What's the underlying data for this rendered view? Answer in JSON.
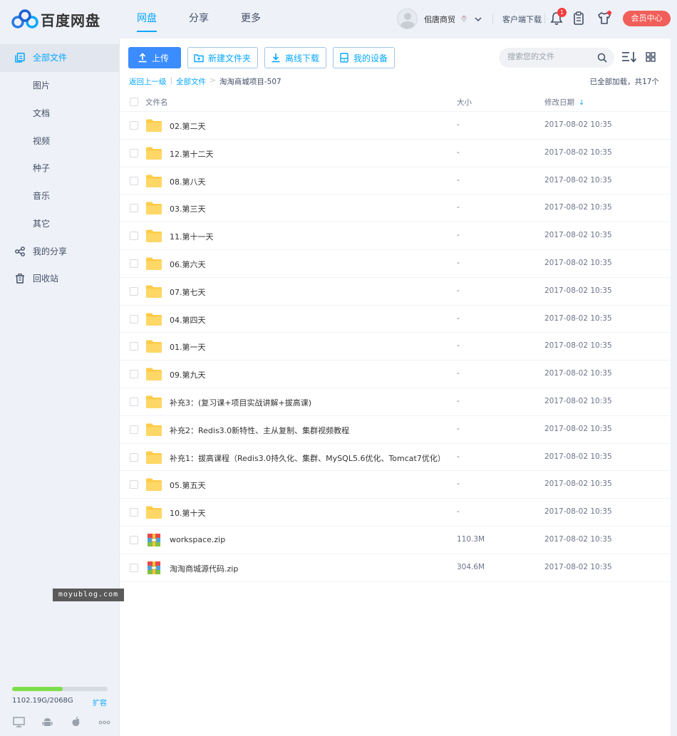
{
  "header": {
    "logo_text": "百度网盘",
    "nav": [
      {
        "label": "网盘",
        "active": true
      },
      {
        "label": "分享",
        "active": false
      },
      {
        "label": "更多",
        "active": false
      }
    ],
    "username": "佀唐商贸",
    "client_download": "客户端下载",
    "notification_count": "1",
    "vip_button": "会员中心"
  },
  "sidebar": {
    "items": [
      {
        "label": "全部文件",
        "icon": "files-icon",
        "active": true
      },
      {
        "label": "图片"
      },
      {
        "label": "文档"
      },
      {
        "label": "视频"
      },
      {
        "label": "种子"
      },
      {
        "label": "音乐"
      },
      {
        "label": "其它"
      },
      {
        "label": "我的分享",
        "icon": "share-icon"
      },
      {
        "label": "回收站",
        "icon": "trash-icon"
      }
    ],
    "storage": {
      "text": "1102.19G/2068G",
      "used_fraction": 0.533,
      "expand_label": "扩容"
    }
  },
  "toolbar": {
    "upload": "上传",
    "new_folder": "新建文件夹",
    "offline_download": "离线下载",
    "my_devices": "我的设备"
  },
  "search": {
    "placeholder": "搜索您的文件"
  },
  "breadcrumb": {
    "back": "返回上一级",
    "root": "全部文件",
    "current": "淘淘商城项目-507"
  },
  "load_status": "已全部加载，共17个",
  "table": {
    "columns": {
      "name": "文件名",
      "size": "大小",
      "date": "修改日期"
    },
    "rows": [
      {
        "name": "02.第二天",
        "size": "-",
        "date": "2017-08-02 10:35",
        "type": "folder"
      },
      {
        "name": "12.第十二天",
        "size": "-",
        "date": "2017-08-02 10:35",
        "type": "folder"
      },
      {
        "name": "08.第八天",
        "size": "-",
        "date": "2017-08-02 10:35",
        "type": "folder"
      },
      {
        "name": "03.第三天",
        "size": "-",
        "date": "2017-08-02 10:35",
        "type": "folder"
      },
      {
        "name": "11.第十一天",
        "size": "-",
        "date": "2017-08-02 10:35",
        "type": "folder"
      },
      {
        "name": "06.第六天",
        "size": "-",
        "date": "2017-08-02 10:35",
        "type": "folder"
      },
      {
        "name": "07.第七天",
        "size": "-",
        "date": "2017-08-02 10:35",
        "type": "folder"
      },
      {
        "name": "04.第四天",
        "size": "-",
        "date": "2017-08-02 10:35",
        "type": "folder"
      },
      {
        "name": "01.第一天",
        "size": "-",
        "date": "2017-08-02 10:35",
        "type": "folder"
      },
      {
        "name": "09.第九天",
        "size": "-",
        "date": "2017-08-02 10:35",
        "type": "folder"
      },
      {
        "name": "补充3：(复习课+项目实战讲解+拔高课)",
        "size": "-",
        "date": "2017-08-02 10:35",
        "type": "folder"
      },
      {
        "name": "补充2：Redis3.0新特性、主从复制、集群视频教程",
        "size": "-",
        "date": "2017-08-02 10:35",
        "type": "folder"
      },
      {
        "name": "补充1：拔高课程（Redis3.0持久化、集群、MySQL5.6优化、Tomcat7优化）",
        "size": "-",
        "date": "2017-08-02 10:35",
        "type": "folder"
      },
      {
        "name": "05.第五天",
        "size": "-",
        "date": "2017-08-02 10:35",
        "type": "folder"
      },
      {
        "name": "10.第十天",
        "size": "-",
        "date": "2017-08-02 10:35",
        "type": "folder"
      },
      {
        "name": "workspace.zip",
        "size": "110.3M",
        "date": "2017-08-02 10:35",
        "type": "zip"
      },
      {
        "name": "淘淘商城源代码.zip",
        "size": "304.6M",
        "date": "2017-08-02 10:35",
        "type": "zip"
      }
    ]
  },
  "watermark": "moyublog.com",
  "colors": {
    "accent": "#06a7ff",
    "primary_button": "#3b8cff",
    "vip": "#f25e59",
    "folder": "#ffd04e",
    "storage_fill": "#7dde4a"
  }
}
